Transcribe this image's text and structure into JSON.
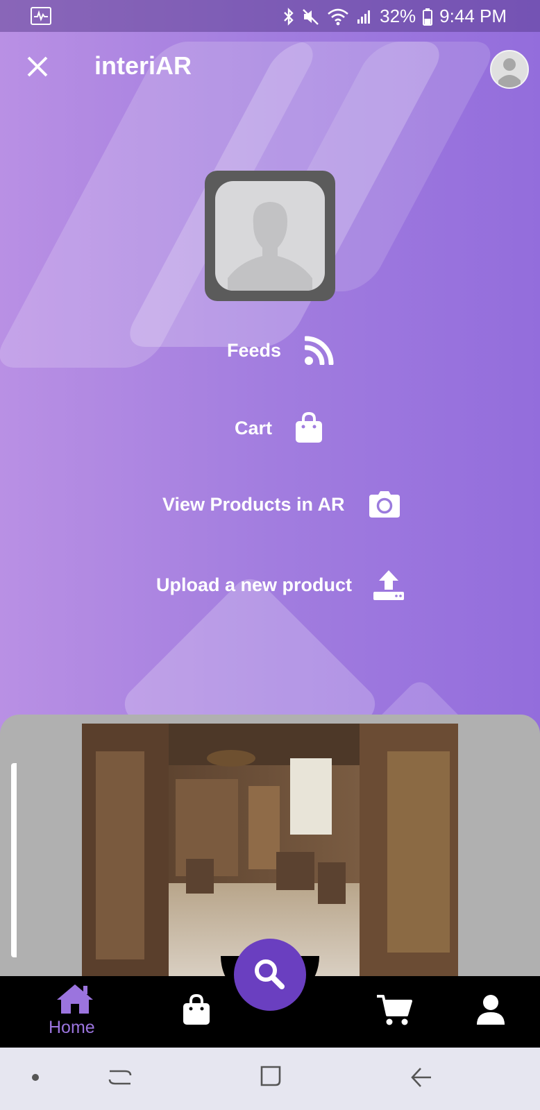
{
  "status_bar": {
    "battery": "32%",
    "time": "9:44 PM",
    "icons": [
      "activity-icon",
      "bluetooth-icon",
      "mute-icon",
      "wifi-icon",
      "signal-icon",
      "battery-icon"
    ]
  },
  "app_bar": {
    "title": "interiAR",
    "close_icon": "close-icon",
    "avatar_icon": "account-avatar"
  },
  "menu": {
    "items": [
      {
        "label": "Feeds",
        "icon": "rss-feed-icon"
      },
      {
        "label": "Cart",
        "icon": "shopping-bag-icon"
      },
      {
        "label": "View Products in AR",
        "icon": "camera-icon"
      },
      {
        "label": "Upload a new product",
        "icon": "upload-icon"
      }
    ]
  },
  "bottom_nav": {
    "items": [
      {
        "label": "Home",
        "icon": "home-icon",
        "active": true
      },
      {
        "label": "",
        "icon": "shopping-bag-icon",
        "active": false
      },
      {
        "label": "",
        "icon": "search-icon",
        "active": false
      },
      {
        "label": "",
        "icon": "cart-icon",
        "active": false
      },
      {
        "label": "",
        "icon": "user-icon",
        "active": false
      }
    ]
  },
  "system_nav": {
    "icons": [
      "dot-icon",
      "recents-icon",
      "home-square-icon",
      "back-icon"
    ]
  },
  "colors": {
    "accent": "#6a3fc0",
    "purple_light": "#b990e4",
    "purple_dark": "#936ddc",
    "nav_active": "#9b74de"
  }
}
